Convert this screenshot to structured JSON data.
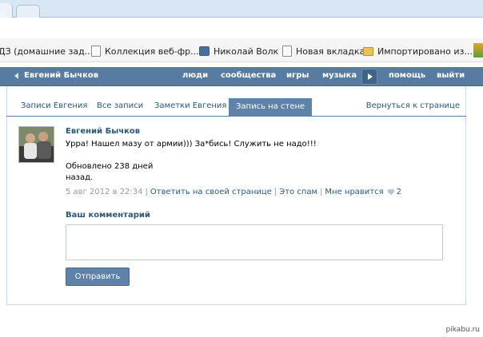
{
  "browser": {
    "bookmarks": [
      {
        "label": "ДЗ (домашние зад...",
        "icon": "page-icon"
      },
      {
        "label": "Коллекция веб-фр...",
        "icon": "page-icon"
      },
      {
        "label": "Николай Волк",
        "icon": "vk-icon"
      },
      {
        "label": "Новая вкладка",
        "icon": "page-icon"
      },
      {
        "label": "Импортировано из...",
        "icon": "folder-icon"
      }
    ]
  },
  "header": {
    "user_name": "Евгений Бычков",
    "nav": [
      "люди",
      "сообщества",
      "игры",
      "музыка",
      "помощь",
      "выйти"
    ]
  },
  "tabs": {
    "items": [
      "Записи Евгения",
      "Все записи",
      "Заметки Евгения",
      "Запись на стене"
    ],
    "active": "Запись на стене",
    "back_link": "Вернуться к странице"
  },
  "post": {
    "author": "Евгений Бычков",
    "text_line1": "Урра! Нашел мазу от армии))) За*бись! Служить не надо!!!",
    "text_line2": "Обновлено 238 дней",
    "text_line3": "назад.",
    "date": "5 авг 2012 в 22:34",
    "reply_link": "Ответить на своей странице",
    "spam_link": "Это спам",
    "like_link": "Мне нравится",
    "like_count": "2"
  },
  "comment": {
    "label": "Ваш комментарий",
    "value": "",
    "submit_label": "Отправить"
  },
  "watermark": "pikabu.ru",
  "colors": {
    "header_bg": "#587ba2",
    "link": "#2b587a",
    "button_bg": "#5e82a8"
  }
}
